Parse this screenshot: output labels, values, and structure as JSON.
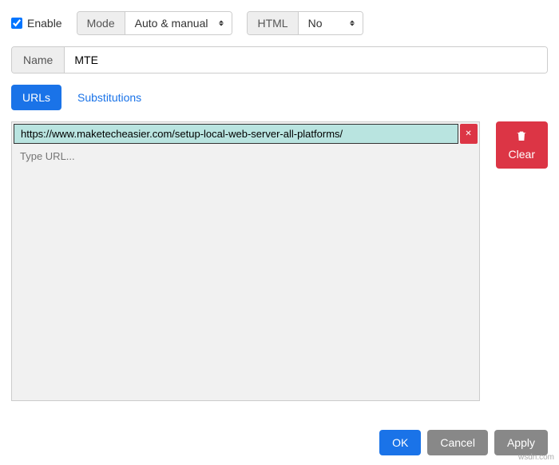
{
  "enable": {
    "label": "Enable",
    "checked": true
  },
  "mode": {
    "label": "Mode",
    "value": "Auto & manual"
  },
  "html": {
    "label": "HTML",
    "value": "No"
  },
  "name": {
    "label": "Name",
    "value": "MTE"
  },
  "tabs": {
    "urls": "URLs",
    "subs": "Substitutions"
  },
  "urls": {
    "entries": [
      {
        "value": "https://www.maketecheasier.com/setup-local-web-server-all-platforms/"
      }
    ],
    "placeholder": "Type URL..."
  },
  "buttons": {
    "clear": "Clear",
    "ok": "OK",
    "cancel": "Cancel",
    "apply": "Apply"
  },
  "watermark": "wsdn.com"
}
